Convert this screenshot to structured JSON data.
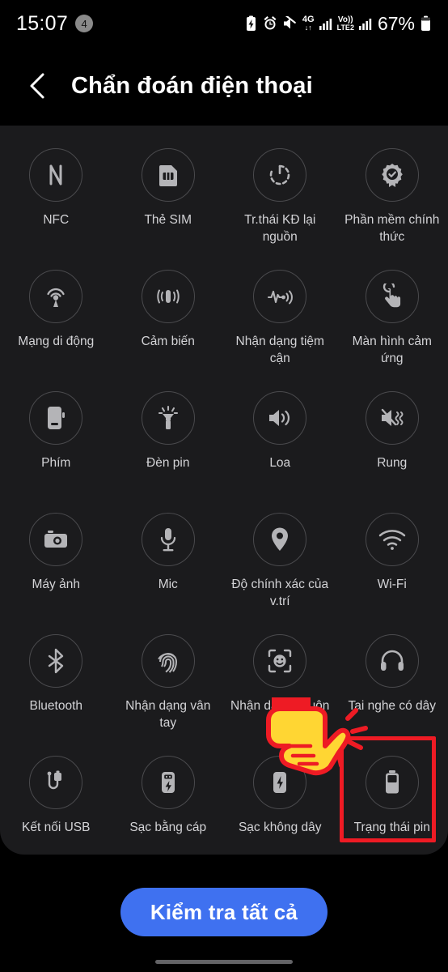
{
  "status_bar": {
    "clock": "15:07",
    "notification_count": "4",
    "battery_percent": "67%",
    "network_top": "4G",
    "network_bottom": "LTE2",
    "volte_label": "Vo))",
    "icons": [
      "battery-saver-icon",
      "alarm-icon",
      "mute-icon",
      "signal-bars-icon",
      "volte-icon",
      "signal-bars-icon",
      "battery-icon"
    ]
  },
  "header": {
    "back_icon": "chevron-left-icon",
    "title": "Chẩn đoán điện thoại"
  },
  "partial_row_above": [
    "",
    "",
    "",
    ""
  ],
  "grid": {
    "tiles": [
      {
        "label": "NFC",
        "icon": "nfc-icon"
      },
      {
        "label": "Thẻ SIM",
        "icon": "sim-card-icon"
      },
      {
        "label": "Tr.thái KĐ lại nguồn",
        "icon": "restart-status-icon"
      },
      {
        "label": "Phần mềm chính thức",
        "icon": "official-software-badge-icon"
      },
      {
        "label": "Mạng di động",
        "icon": "mobile-network-icon"
      },
      {
        "label": "Cảm biến",
        "icon": "sensor-icon"
      },
      {
        "label": "Nhận dạng tiệm cận",
        "icon": "proximity-sensor-icon"
      },
      {
        "label": "Màn hình cảm ứng",
        "icon": "touchscreen-icon"
      },
      {
        "label": "Phím",
        "icon": "hardware-key-icon"
      },
      {
        "label": "Đèn pin",
        "icon": "flashlight-icon"
      },
      {
        "label": "Loa",
        "icon": "speaker-icon"
      },
      {
        "label": "Rung",
        "icon": "vibration-icon"
      },
      {
        "label": "Máy ảnh",
        "icon": "camera-icon"
      },
      {
        "label": "Mic",
        "icon": "microphone-icon"
      },
      {
        "label": "Độ chính xác của v.trí",
        "icon": "location-pin-icon"
      },
      {
        "label": "Wi-Fi",
        "icon": "wifi-icon"
      },
      {
        "label": "Bluetooth",
        "icon": "bluetooth-icon"
      },
      {
        "label": "Nhận dạng vân tay",
        "icon": "fingerprint-icon"
      },
      {
        "label": "Nhận dạng khuôn mặt",
        "icon": "face-recognition-icon"
      },
      {
        "label": "Tai nghe có dây",
        "icon": "wired-headset-icon"
      },
      {
        "label": "Kết nối USB",
        "icon": "usb-cable-icon"
      },
      {
        "label": "Sạc bằng cáp",
        "icon": "wired-charging-icon"
      },
      {
        "label": "Sạc không dây",
        "icon": "wireless-charging-icon"
      },
      {
        "label": "Trạng thái pin",
        "icon": "battery-status-icon"
      }
    ]
  },
  "footer": {
    "check_all_label": "Kiểm tra tất cả",
    "accent_color": "#3f71f0"
  },
  "annotation": {
    "highlight_color": "#ee1b24",
    "hand_fill": "#ffd633",
    "hand_stroke": "#ee1b24",
    "target_label": "Trạng thái pin"
  }
}
